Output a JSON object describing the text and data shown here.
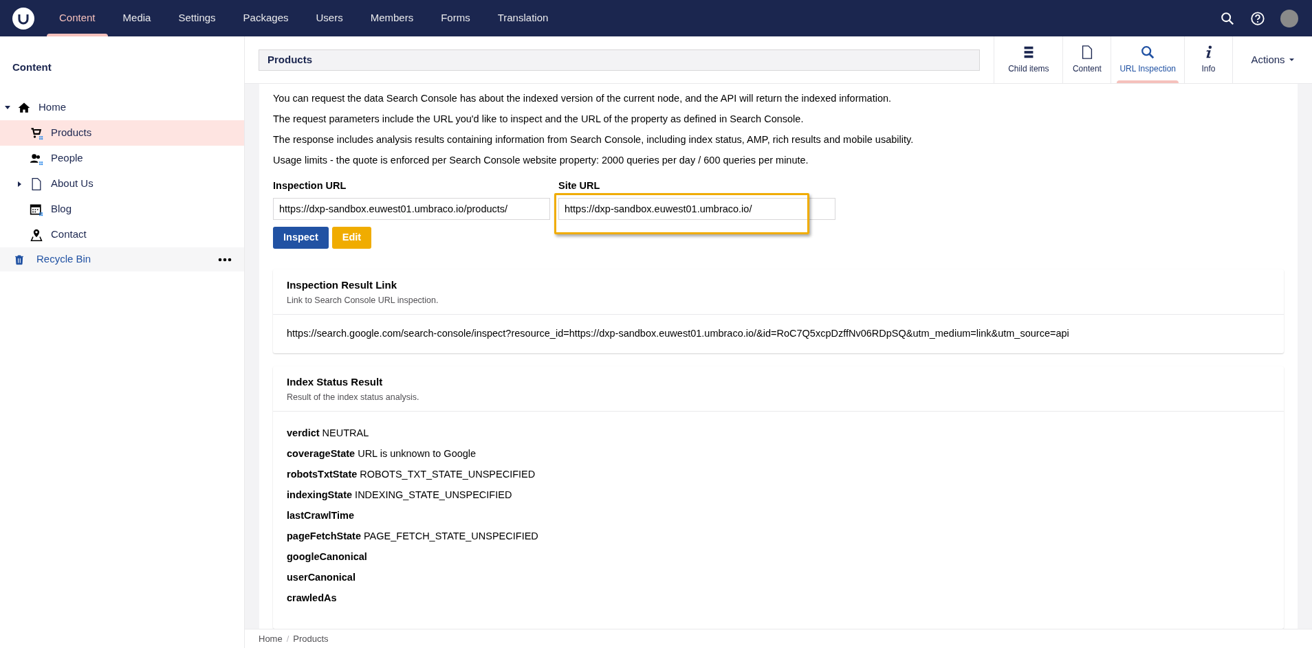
{
  "top_nav": {
    "sections": [
      {
        "label": "Content",
        "selected": true
      },
      {
        "label": "Media",
        "selected": false
      },
      {
        "label": "Settings",
        "selected": false
      },
      {
        "label": "Packages",
        "selected": false
      },
      {
        "label": "Users",
        "selected": false
      },
      {
        "label": "Members",
        "selected": false
      },
      {
        "label": "Forms",
        "selected": false
      },
      {
        "label": "Translation",
        "selected": false
      }
    ]
  },
  "sidebar": {
    "title": "Content",
    "tree": [
      {
        "label": "Home",
        "kind": "home",
        "selected": false,
        "expanded": true,
        "children": [
          {
            "label": "Products",
            "kind": "cart",
            "selected": true
          },
          {
            "label": "People",
            "kind": "people",
            "selected": false
          },
          {
            "label": "About Us",
            "kind": "document",
            "selected": false,
            "expanded": false
          },
          {
            "label": "Blog",
            "kind": "calendar",
            "selected": false
          },
          {
            "label": "Contact",
            "kind": "pin",
            "selected": false
          }
        ]
      }
    ],
    "recycle_bin": {
      "label": "Recycle Bin"
    }
  },
  "header": {
    "name": "Products",
    "apps": [
      {
        "label": "Child items",
        "kind": "list",
        "selected": false
      },
      {
        "label": "Content",
        "kind": "document",
        "selected": false
      },
      {
        "label": "URL Inspection",
        "kind": "search",
        "selected": true
      },
      {
        "label": "Info",
        "kind": "info",
        "selected": false
      }
    ],
    "actions": "Actions"
  },
  "intro": [
    "You can request the data Search Console has about the indexed version of the current node, and the API will return the indexed information.",
    "The request parameters include the URL you'd like to inspect and the URL of the property as defined in Search Console.",
    "The response includes analysis results containing information from Search Console, including index status, AMP, rich results and mobile usability.",
    "Usage limits - the quote is enforced per Search Console website property: 2000 queries per day / 600 queries per minute."
  ],
  "fields": [
    {
      "label": "Inspection URL",
      "value": "https://dxp-sandbox.euwest01.umbraco.io/products/",
      "highlighted": false
    },
    {
      "label": "Site URL",
      "value": "https://dxp-sandbox.euwest01.umbraco.io/",
      "highlighted": true
    }
  ],
  "buttons": [
    {
      "label": "Inspect",
      "kind": "primary"
    },
    {
      "label": "Edit",
      "kind": "warning"
    }
  ],
  "cards": [
    {
      "kind": "link",
      "title": "Inspection Result Link",
      "description": "Link to Search Console URL inspection.",
      "text": "https://search.google.com/search-console/inspect?resource_id=https://dxp-sandbox.euwest01.umbraco.io/&id=RoC7Q5xcpDzffNv06RDpSQ&utm_medium=link&utm_source=api"
    },
    {
      "kind": "properties",
      "title": "Index Status Result",
      "description": "Result of the index status analysis.",
      "properties": [
        {
          "name": "verdict",
          "value": "NEUTRAL"
        },
        {
          "name": "coverageState",
          "value": "URL is unknown to Google"
        },
        {
          "name": "robotsTxtState",
          "value": "ROBOTS_TXT_STATE_UNSPECIFIED"
        },
        {
          "name": "indexingState",
          "value": "INDEXING_STATE_UNSPECIFIED"
        },
        {
          "name": "lastCrawlTime"
        },
        {
          "name": "pageFetchState",
          "value": "PAGE_FETCH_STATE_UNSPECIFIED"
        },
        {
          "name": "googleCanonical"
        },
        {
          "name": "userCanonical"
        },
        {
          "name": "crawledAs"
        }
      ]
    }
  ],
  "breadcrumb": {
    "items": [
      "Home",
      "Products"
    ],
    "separator": "/"
  }
}
